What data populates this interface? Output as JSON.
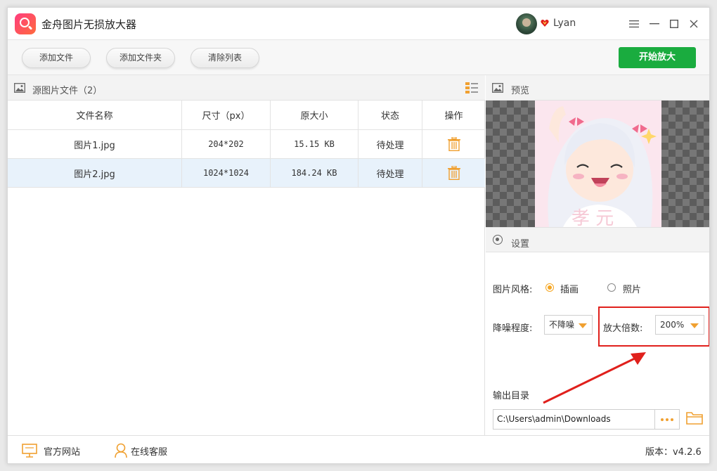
{
  "app": {
    "title": "金舟图片无损放大器"
  },
  "user": {
    "name": "Lyan"
  },
  "toolbar": {
    "add_file": "添加文件",
    "add_folder": "添加文件夹",
    "clear_list": "清除列表",
    "start": "开始放大"
  },
  "source": {
    "title": "源图片文件（2）",
    "columns": [
      "文件名称",
      "尺寸（px）",
      "原大小",
      "状态",
      "操作"
    ],
    "rows": [
      {
        "name": "图片1.jpg",
        "size": "204*202",
        "filesize": "15.15 KB",
        "status": "待处理"
      },
      {
        "name": "图片2.jpg",
        "size": "1024*1024",
        "filesize": "184.24 KB",
        "status": "待处理"
      }
    ]
  },
  "preview": {
    "title": "预览"
  },
  "settings": {
    "title": "设置",
    "style_label": "图片风格:",
    "style_options": [
      "插画",
      "照片"
    ],
    "style_selected": "插画",
    "denoise_label": "降噪程度:",
    "denoise_value": "不降噪",
    "scale_label": "放大倍数:",
    "scale_value": "200%",
    "output_label": "输出目录",
    "output_path": "C:\\Users\\admin\\Downloads"
  },
  "status": {
    "website": "官方网站",
    "support": "在线客服",
    "version_label": "版本：",
    "version": "v4.2.6"
  },
  "colors": {
    "primary": "#1aac3f",
    "accent": "#f5a623",
    "highlight": "#e0201c"
  }
}
